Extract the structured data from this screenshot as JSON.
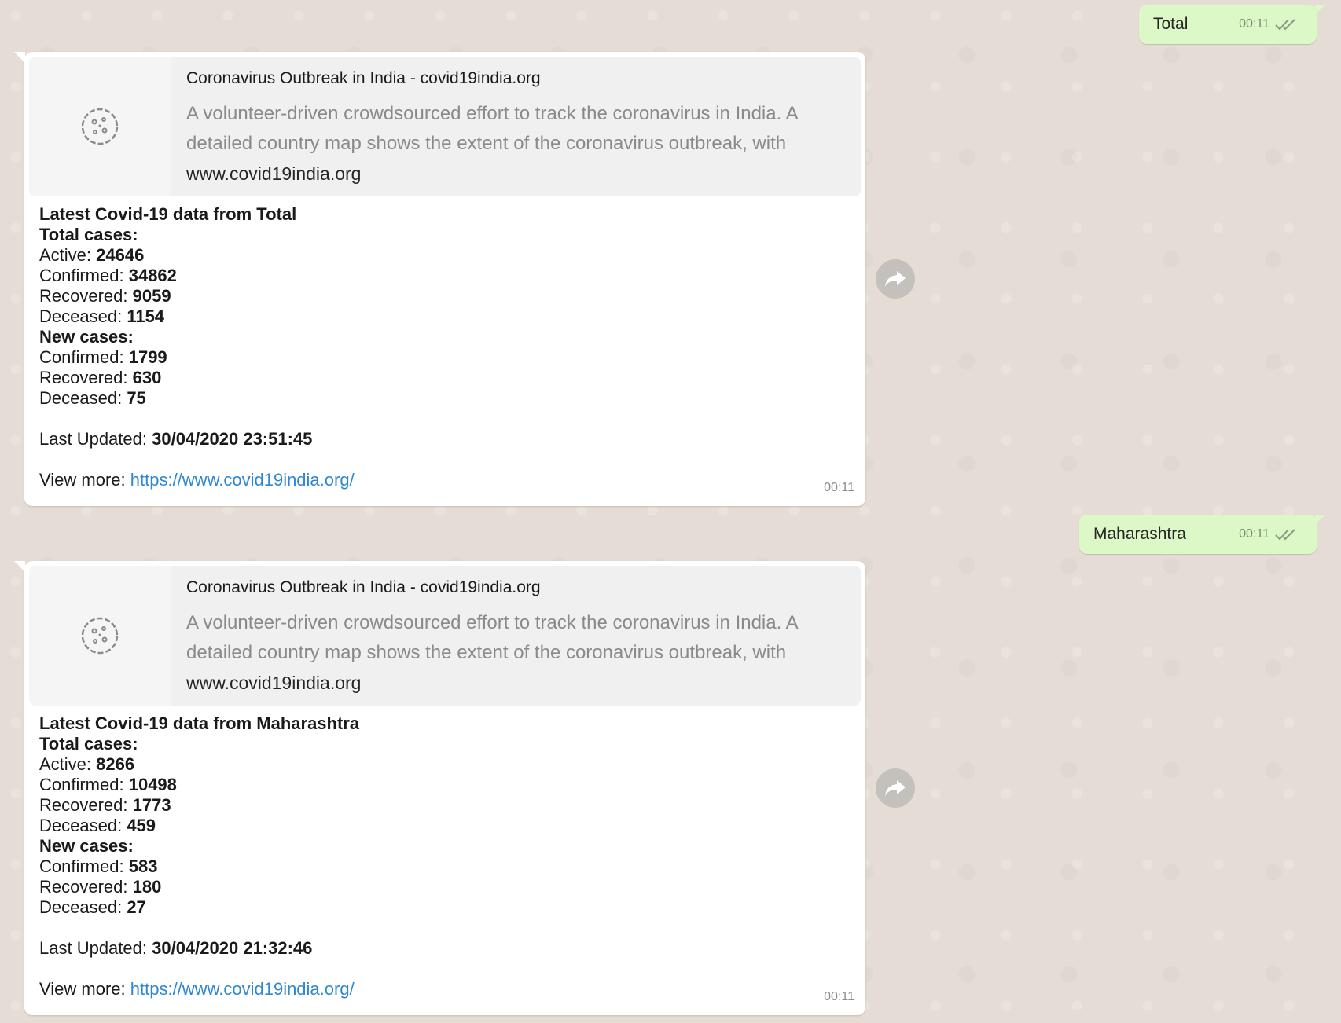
{
  "outgoing": [
    {
      "text": "Total",
      "time": "00:11"
    },
    {
      "text": "Maharashtra",
      "time": "00:11"
    }
  ],
  "incoming": [
    {
      "preview": {
        "title": "Coronavirus Outbreak in India - covid19india.org",
        "description": "A volunteer-driven crowdsourced effort to track the coronavirus in India. A detailed country map shows the extent of the coronavirus outbreak, with",
        "domain": "www.covid19india.org"
      },
      "heading": "Latest Covid-19 data from Total",
      "total_label": "Total cases:",
      "total": {
        "active": "24646",
        "confirmed": "34862",
        "recovered": "9059",
        "deceased": "1154"
      },
      "new_label": "New cases:",
      "new": {
        "confirmed": "1799",
        "recovered": "630",
        "deceased": "75"
      },
      "updated_label": "Last Updated:",
      "updated": "30/04/2020 23:51:45",
      "view_more_label": "View more:",
      "link": "https://www.covid19india.org/",
      "time": "00:11"
    },
    {
      "preview": {
        "title": "Coronavirus Outbreak in India - covid19india.org",
        "description": "A volunteer-driven crowdsourced effort to track the coronavirus in India. A detailed country map shows the extent of the coronavirus outbreak, with",
        "domain": "www.covid19india.org"
      },
      "heading": "Latest Covid-19 data from Maharashtra",
      "total_label": "Total cases:",
      "total": {
        "active": "8266",
        "confirmed": "10498",
        "recovered": "1773",
        "deceased": "459"
      },
      "new_label": "New cases:",
      "new": {
        "confirmed": "583",
        "recovered": "180",
        "deceased": "27"
      },
      "updated_label": "Last Updated:",
      "updated": "30/04/2020 21:32:46",
      "view_more_label": "View more:",
      "link": "https://www.covid19india.org/",
      "time": "00:11"
    }
  ],
  "labels": {
    "active": "Active:",
    "confirmed": "Confirmed:",
    "recovered": "Recovered:",
    "deceased": "Deceased:"
  },
  "colors": {
    "outgoing_bubble": "#dcf8c6",
    "incoming_bubble": "#ffffff",
    "link": "#2e87d4",
    "background": "#e5ddd5"
  },
  "icons": {
    "preview_thumbnail": "virus-icon",
    "forward": "forward-arrow-icon",
    "read_receipt": "double-check-icon"
  }
}
